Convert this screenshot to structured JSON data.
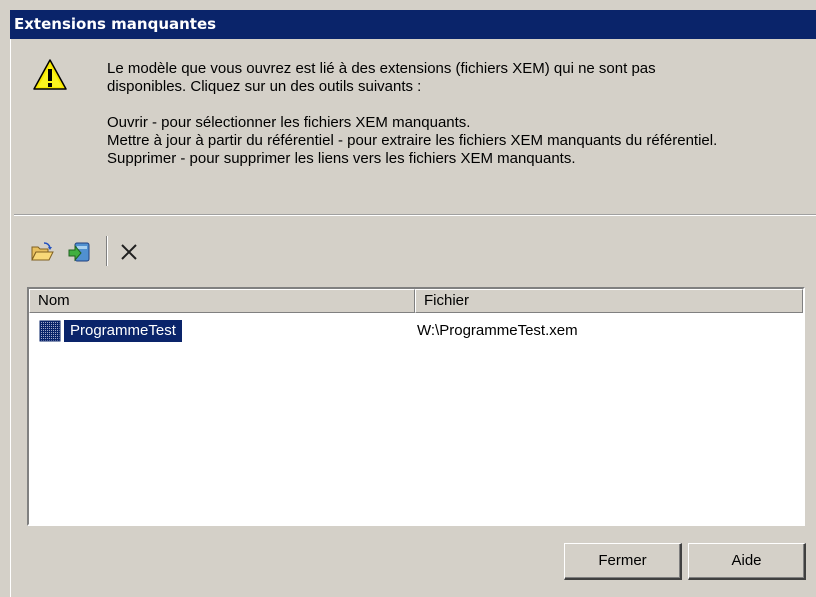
{
  "dialog": {
    "title": "Extensions manquantes",
    "message": {
      "line1": "Le modèle que vous ouvrez est lié à des extensions  (fichiers XEM) qui ne sont pas",
      "line2": "disponibles. Cliquez sur un des outils suivants :",
      "line3": "Ouvrir - pour sélectionner les fichiers XEM manquants.",
      "line4": "Mettre à jour à partir du référentiel - pour extraire les fichiers XEM manquants du référentiel.",
      "line5": "Supprimer - pour supprimer les liens vers les fichiers XEM manquants."
    }
  },
  "toolbar": {
    "icons": [
      "open-folder-icon",
      "update-from-repository-icon",
      "delete-icon"
    ]
  },
  "list": {
    "columns": {
      "name": "Nom",
      "file": "Fichier"
    },
    "rows": [
      {
        "name": "ProgrammeTest",
        "file": "W:\\ProgrammeTest.xem",
        "selected": true
      }
    ]
  },
  "buttons": {
    "close": "Fermer",
    "help": "Aide"
  },
  "colors": {
    "titlebar": "#0a246a",
    "selection": "#0a246a",
    "face": "#d4d0c8"
  }
}
